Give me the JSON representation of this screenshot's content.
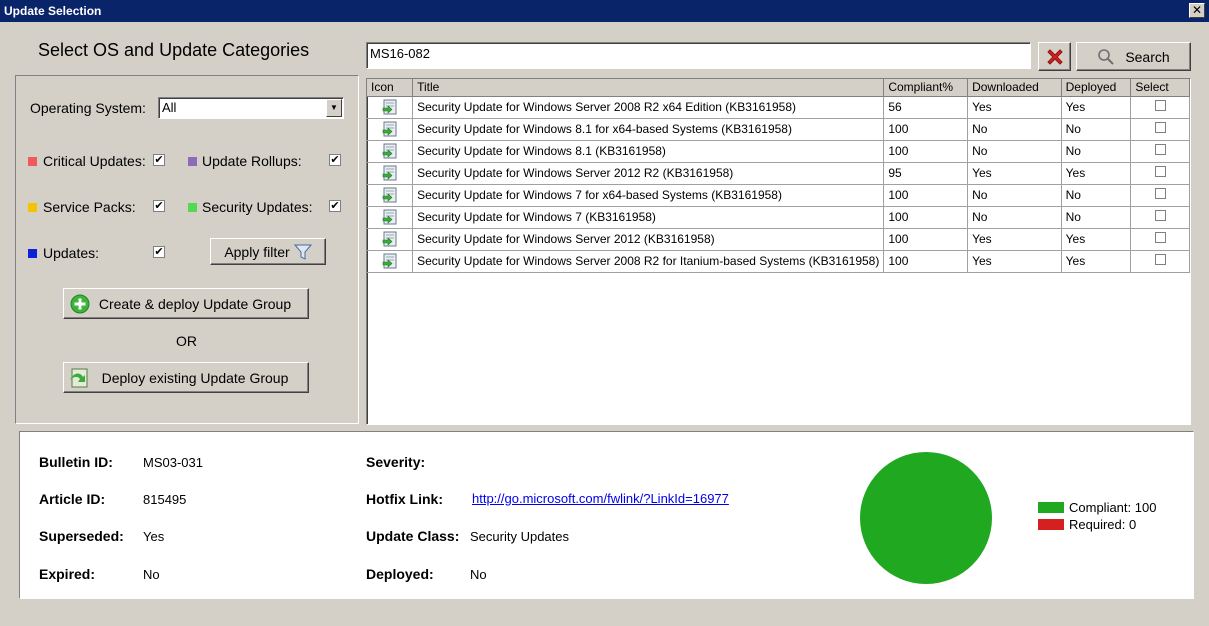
{
  "window": {
    "title": "Update Selection",
    "close_glyph": "✕"
  },
  "heading": "Select OS and Update Categories",
  "filters": {
    "os_label": "Operating System:",
    "os_value": "All",
    "categories": [
      {
        "label": "Critical Updates:",
        "color": "#f05a5a",
        "checked": true
      },
      {
        "label": "Update Rollups:",
        "color": "#8e6bb8",
        "checked": true
      },
      {
        "label": "Service Packs:",
        "color": "#f5c400",
        "checked": true
      },
      {
        "label": "Security Updates:",
        "color": "#54d854",
        "checked": true
      },
      {
        "label": "Updates:",
        "color": "#0a22d8",
        "checked": true
      }
    ],
    "check_glyph": "✔",
    "apply_label": "Apply filter",
    "create_label": "Create & deploy Update Group",
    "or_label": "OR",
    "deploy_label": "Deploy existing Update Group"
  },
  "search": {
    "value": "MS16-082",
    "button_label": "Search"
  },
  "grid": {
    "columns": [
      "Icon",
      "Title",
      "Compliant%",
      "Downloaded",
      "Deployed",
      "Select"
    ],
    "rows": [
      {
        "title": "Security Update for Windows Server 2008 R2 x64 Edition (KB3161958)",
        "compliant": "56",
        "downloaded": "Yes",
        "deployed": "Yes"
      },
      {
        "title": "Security Update for Windows 8.1 for x64-based Systems (KB3161958)",
        "compliant": "100",
        "downloaded": "No",
        "deployed": "No"
      },
      {
        "title": "Security Update for Windows 8.1 (KB3161958)",
        "compliant": "100",
        "downloaded": "No",
        "deployed": "No"
      },
      {
        "title": "Security Update for Windows Server 2012 R2 (KB3161958)",
        "compliant": "95",
        "downloaded": "Yes",
        "deployed": "Yes"
      },
      {
        "title": "Security Update for Windows 7 for x64-based Systems (KB3161958)",
        "compliant": "100",
        "downloaded": "No",
        "deployed": "No"
      },
      {
        "title": "Security Update for Windows 7 (KB3161958)",
        "compliant": "100",
        "downloaded": "No",
        "deployed": "No"
      },
      {
        "title": "Security Update for Windows Server 2012 (KB3161958)",
        "compliant": "100",
        "downloaded": "Yes",
        "deployed": "Yes"
      },
      {
        "title": "Security Update for Windows Server 2008 R2 for Itanium-based Systems (KB3161958)",
        "compliant": "100",
        "downloaded": "Yes",
        "deployed": "Yes"
      }
    ]
  },
  "details": {
    "bulletin_label": "Bulletin ID:",
    "bulletin_value": "MS03-031",
    "article_label": "Article ID:",
    "article_value": "815495",
    "superseded_label": "Superseded:",
    "superseded_value": "Yes",
    "expired_label": "Expired:",
    "expired_value": "No",
    "severity_label": "Severity:",
    "severity_value": "",
    "hotfix_label": "Hotfix Link:",
    "hotfix_value": "http://go.microsoft.com/fwlink/?LinkId=16977",
    "class_label": "Update Class:",
    "class_value": "Security Updates",
    "deployed_label": "Deployed:",
    "deployed_value": "No"
  },
  "chart_data": {
    "type": "pie",
    "series": [
      {
        "name": "Compliant: 100",
        "value": 100,
        "color": "#20a820"
      },
      {
        "name": "Required: 0",
        "value": 0,
        "color": "#d42020"
      }
    ]
  }
}
